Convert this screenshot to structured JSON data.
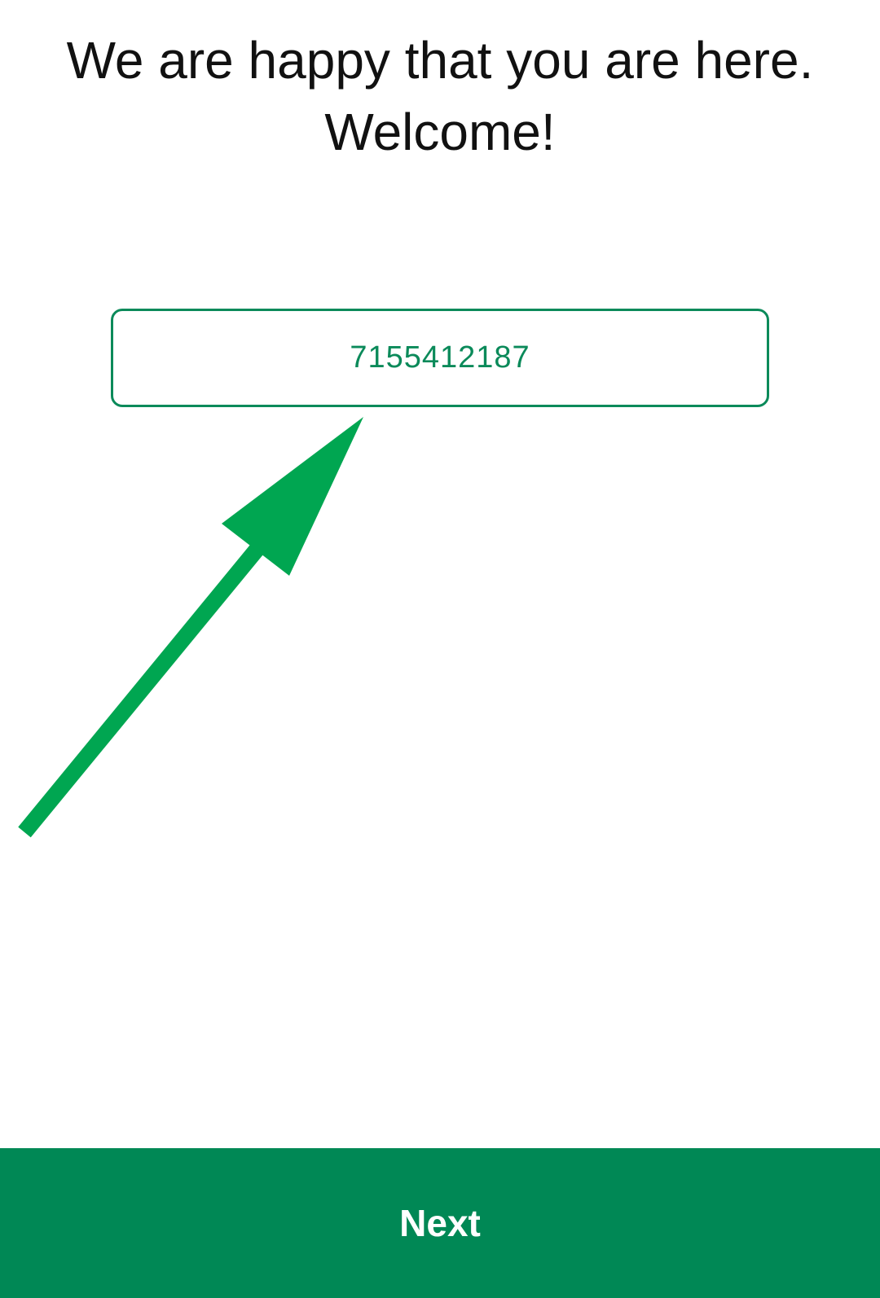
{
  "welcome": {
    "line1": "We are happy that you are here.",
    "line2": "Welcome!"
  },
  "phone_field": {
    "value": "7155412187"
  },
  "footer": {
    "next_label": "Next"
  },
  "colors": {
    "accent": "#008855",
    "field_border": "#0b8a5a",
    "annotation_arrow": "#00a651"
  },
  "icons": {
    "annotation": "arrow-up-right-icon"
  }
}
